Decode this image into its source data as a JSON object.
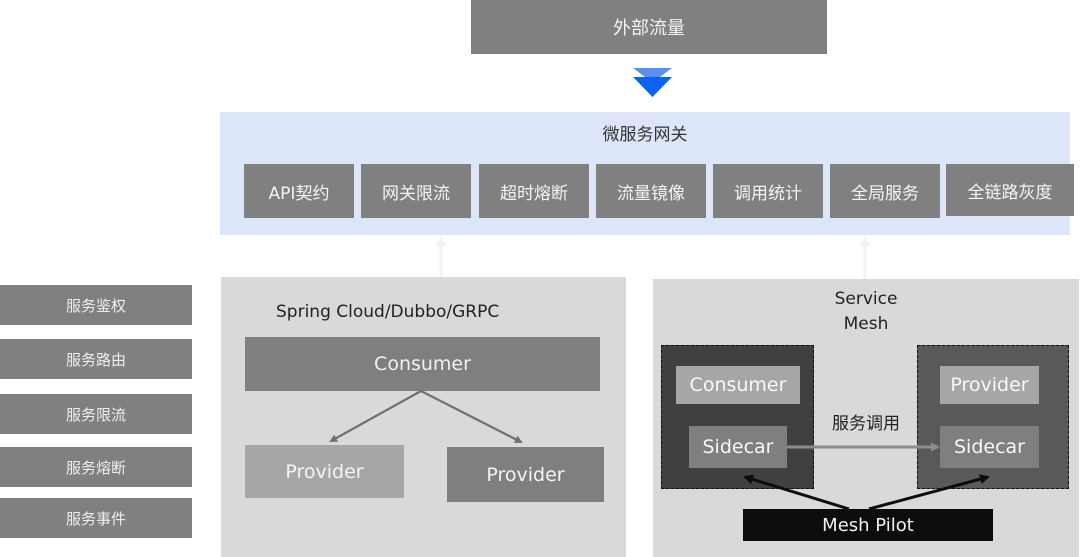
{
  "external_traffic": {
    "label": "外部流量",
    "arrow_icon": "double-chevron-down-icon"
  },
  "gateway": {
    "title": "微服务网关",
    "items": [
      {
        "label": "API契约"
      },
      {
        "label": "网关限流"
      },
      {
        "label": "超时熔断"
      },
      {
        "label": "流量镜像"
      },
      {
        "label": "调用统计"
      },
      {
        "label": "全局服务"
      },
      {
        "label": "全链路灰度"
      }
    ]
  },
  "side_features": [
    {
      "label": "服务鉴权"
    },
    {
      "label": "服务路由"
    },
    {
      "label": "服务限流"
    },
    {
      "label": "服务熔断"
    },
    {
      "label": "服务事件"
    }
  ],
  "left_panel": {
    "title": "Spring Cloud/Dubbo/GRPC",
    "consumer": "Consumer",
    "providers": [
      "Provider",
      "Provider"
    ]
  },
  "right_panel": {
    "title_line1": "Service",
    "title_line2": "Mesh",
    "left_pod": {
      "app": "Consumer",
      "sidecar": "Sidecar"
    },
    "right_pod": {
      "app": "Provider",
      "sidecar": "Sidecar"
    },
    "call_label": "服务调用",
    "control_plane": "Mesh Pilot"
  },
  "colors": {
    "arrow_blue_light": "#5b8ff2",
    "arrow_blue": "#0a64ef",
    "gateway_bg": "#dde6f8",
    "box_gray": "#808080",
    "panel_bg": "#d9d9d9"
  }
}
